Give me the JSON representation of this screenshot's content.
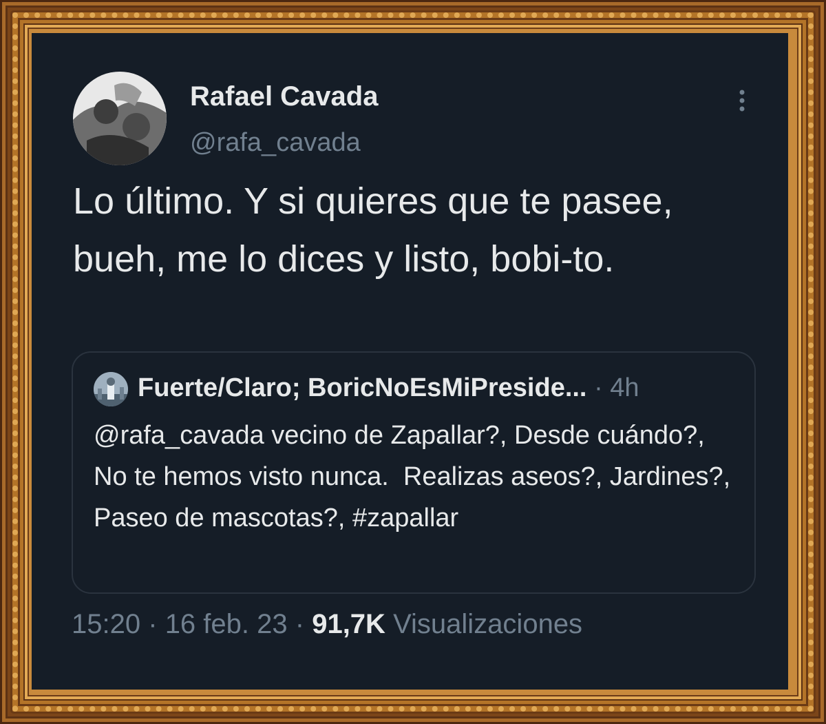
{
  "tweet": {
    "display_name": "Rafael Cavada",
    "handle": "@rafa_cavada",
    "text": "Lo último. Y si quieres que te pasee, bueh, me lo dices y listo, bobi-to.",
    "more_icon": "more-vertical-icon",
    "avatar_icon": "user-avatar"
  },
  "quote": {
    "display_name": "Fuerte/Claro; BoricNoEsMiPreside...",
    "separator": "·",
    "time": "4h",
    "text": "@rafa_cavada vecino de Zapallar?, Desde cuándo?, No te hemos visto nunca.  Realizas aseos?, Jardines?, Paseo de mascotas?, #zapallar"
  },
  "meta": {
    "time": "15:20",
    "dot1": "·",
    "date": "16 feb. 23",
    "dot2": "·",
    "views_count": "91,7K",
    "views_label": "Visualizaciones"
  },
  "colors": {
    "background": "#151d27",
    "text": "#e7e9ea",
    "muted": "#71808f",
    "frame": "#b47428"
  }
}
